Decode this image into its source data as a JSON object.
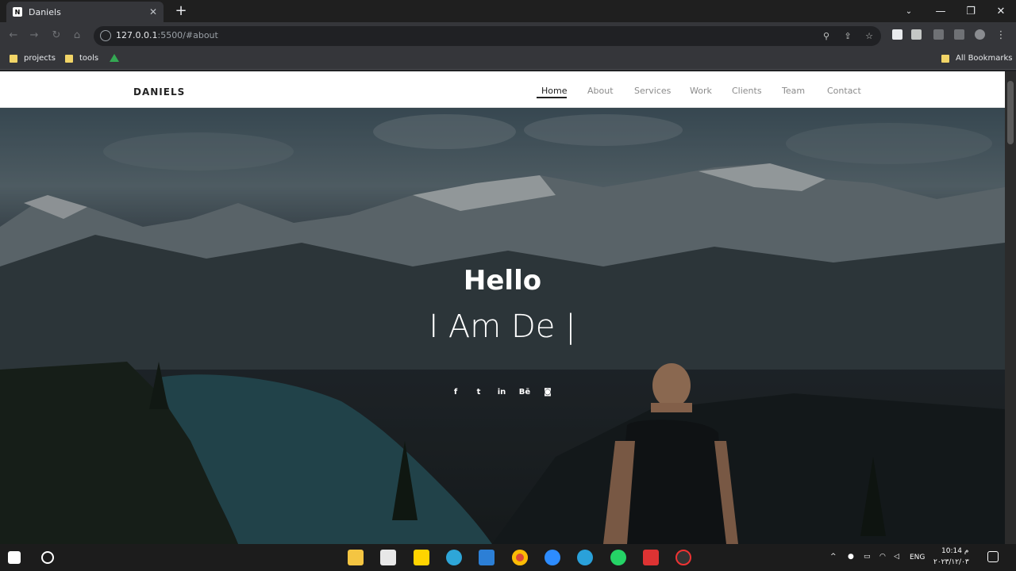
{
  "browser": {
    "tab_title": "Daniels",
    "tab_favicon_letter": "N",
    "url_host": "127.0.0.1",
    "url_rest": ":5500/#about",
    "bookmarks": [
      "projects",
      "tools"
    ],
    "all_bookmarks": "All Bookmarks"
  },
  "site": {
    "brand": "DANIELS",
    "menu": [
      "Home",
      "About",
      "Services",
      "Work",
      "Clients",
      "Team",
      "Contact"
    ],
    "active_menu": "Home",
    "hero_title": "Hello",
    "hero_typed": "I Am De |",
    "social": [
      {
        "icon": "facebook-icon",
        "glyph": "f"
      },
      {
        "icon": "twitter-icon",
        "glyph": "t"
      },
      {
        "icon": "linkedin-icon",
        "glyph": "in"
      },
      {
        "icon": "behance-icon",
        "glyph": "Bē"
      },
      {
        "icon": "instagram-icon",
        "glyph": "◙"
      }
    ]
  },
  "taskbar": {
    "lang": "ENG",
    "time": "10:14 م",
    "date": "٢٠٢٣/١٢/٠٣"
  },
  "colors": {
    "chrome_dark": "#1f1f1f",
    "chrome_toolbar": "#35363a",
    "nav_bg": "#ffffff"
  }
}
